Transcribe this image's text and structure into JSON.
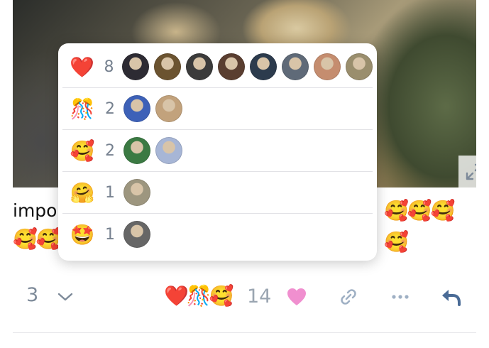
{
  "post": {
    "text_start": "impo",
    "trailing_emojis_line1": "🥰🥰🥰🥰",
    "trailing_emojis_line2": "🥰🥰"
  },
  "reactions_popup": {
    "rows": [
      {
        "emoji": "❤️",
        "count": "8",
        "avatar_colors": [
          "#2d2b33",
          "#6b5330",
          "#3b3b3b",
          "#5a3e30",
          "#2c3b4d",
          "#5f6a78",
          "#c58d6f",
          "#9a8e6d"
        ]
      },
      {
        "emoji": "🎊",
        "count": "2",
        "avatar_colors": [
          "#3d61b8",
          "#c2a27c"
        ]
      },
      {
        "emoji": "🥰",
        "count": "2",
        "avatar_colors": [
          "#3b7a43",
          "#a7b6d6"
        ]
      },
      {
        "emoji": "🤗",
        "count": "1",
        "avatar_colors": [
          "#9d967f"
        ]
      },
      {
        "emoji": "🤩",
        "count": "1",
        "avatar_colors": [
          "#666666"
        ]
      }
    ]
  },
  "footer": {
    "reply_count": "3",
    "reaction_emojis": "❤️🎊🥰",
    "reaction_total": "14",
    "colors": {
      "muted": "#7d8a99",
      "heart": "#f08fcf",
      "reply": "#4a6b96",
      "link": "#9fb0c4"
    }
  },
  "icons": [
    "expand-icon",
    "chevron-down-icon",
    "heart-icon",
    "link-icon",
    "more-icon",
    "reply-icon"
  ]
}
